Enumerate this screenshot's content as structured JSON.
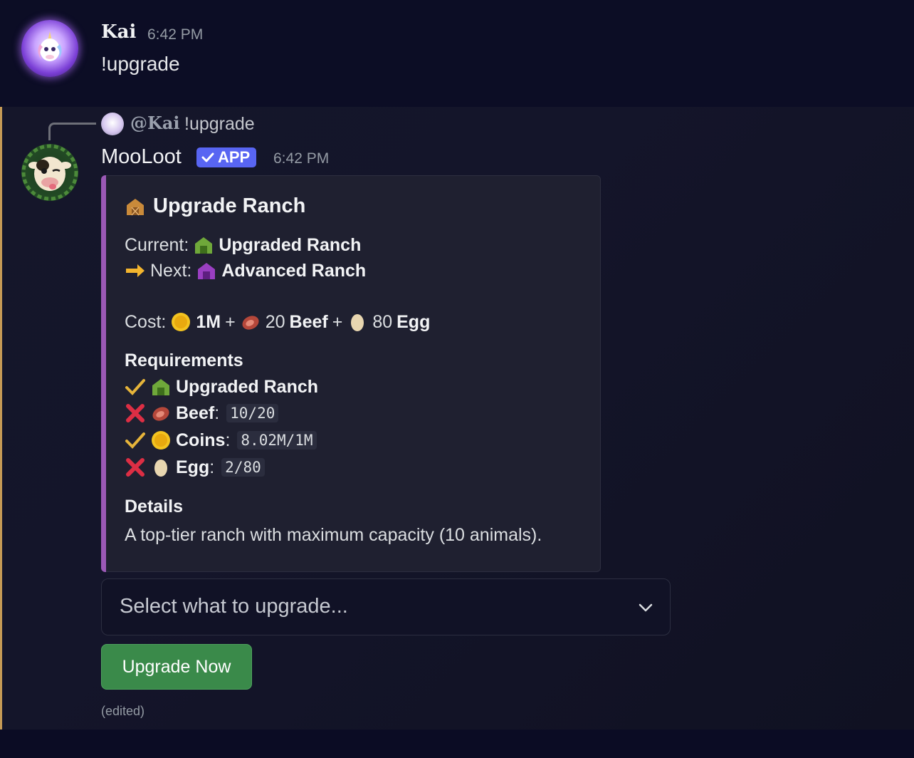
{
  "message1": {
    "author": "Kai",
    "time": "6:42 PM",
    "text": "!upgrade"
  },
  "message2": {
    "reply": {
      "mention": "@Kai",
      "text": "!upgrade"
    },
    "author": "MooLoot",
    "badge": "APP",
    "time": "6:42 PM",
    "embed": {
      "accent_color": "#9b59b6",
      "title": "Upgrade Ranch",
      "current_label": "Current:",
      "current_value": "Upgraded Ranch",
      "next_label": "Next:",
      "next_value": "Advanced Ranch",
      "cost_label": "Cost:",
      "cost_coins": "1M",
      "cost_plus1": "+",
      "cost_beef_qty": "20",
      "cost_beef": "Beef",
      "cost_plus2": "+",
      "cost_egg_qty": "80",
      "cost_egg": "Egg",
      "requirements_heading": "Requirements",
      "requirements": [
        {
          "status": "check-icon",
          "name": "Upgraded Ranch",
          "progress": ""
        },
        {
          "status": "cross-icon",
          "name": "Beef",
          "colon": ":",
          "progress": "10/20"
        },
        {
          "status": "check-icon",
          "name": "Coins",
          "colon": ":",
          "progress": "8.02M/1M"
        },
        {
          "status": "cross-icon",
          "name": "Egg",
          "colon": ":",
          "progress": "2/80"
        }
      ],
      "details_heading": "Details",
      "details_text": "A top-tier ranch with maximum capacity (10 animals)."
    },
    "select_placeholder": "Select what to upgrade...",
    "button_label": "Upgrade Now",
    "edited": "(edited)"
  }
}
